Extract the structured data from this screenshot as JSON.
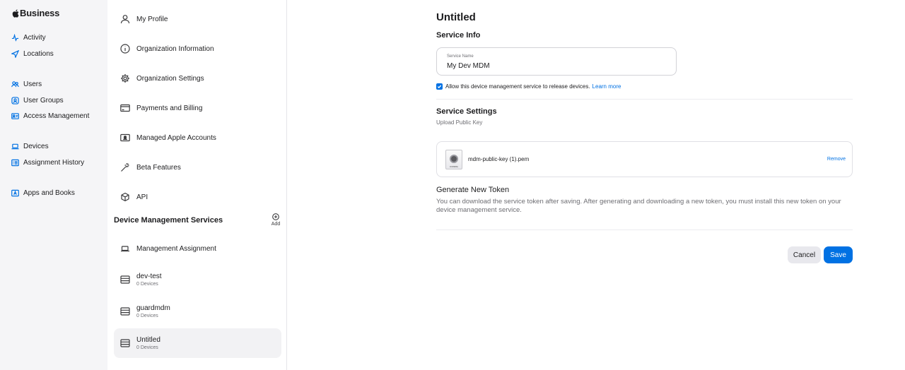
{
  "sidebar": {
    "brand": "Business",
    "items": [
      {
        "label": "Activity",
        "icon": "activity-icon"
      },
      {
        "label": "Locations",
        "icon": "location-arrow-icon"
      },
      {
        "label": "Users",
        "icon": "users-icon"
      },
      {
        "label": "User Groups",
        "icon": "user-group-icon"
      },
      {
        "label": "Access Management",
        "icon": "id-card-icon"
      },
      {
        "label": "Devices",
        "icon": "laptop-icon"
      },
      {
        "label": "Assignment History",
        "icon": "list-icon"
      },
      {
        "label": "Apps and Books",
        "icon": "app-store-icon"
      }
    ]
  },
  "settings_nav": {
    "items": [
      {
        "label": "My Profile",
        "icon": "person-icon"
      },
      {
        "label": "Organization Information",
        "icon": "info-icon"
      },
      {
        "label": "Organization Settings",
        "icon": "gear-icon"
      },
      {
        "label": "Payments and Billing",
        "icon": "credit-card-icon"
      },
      {
        "label": "Managed Apple Accounts",
        "icon": "account-card-icon"
      },
      {
        "label": "Beta Features",
        "icon": "magic-wand-icon"
      },
      {
        "label": "API",
        "icon": "cube-icon"
      }
    ],
    "dms_title": "Device Management Services",
    "add_label": "Add",
    "dms_items": [
      {
        "label": "Management Assignment",
        "icon": "laptop-icon"
      },
      {
        "label": "dev-test",
        "sub": "0 Devices",
        "icon": "server-icon"
      },
      {
        "label": "guardmdm",
        "sub": "0 Devices",
        "icon": "server-icon"
      },
      {
        "label": "Untitled",
        "sub": "0 Devices",
        "icon": "server-icon",
        "selected": true
      }
    ]
  },
  "main": {
    "title": "Untitled",
    "service_info_title": "Service Info",
    "service_name_label": "Service Name",
    "service_name_value": "My Dev MDM",
    "allow_release_text": "Allow this device management service to release devices.",
    "allow_release_checked": true,
    "learn_more": "Learn more",
    "service_settings_title": "Service Settings",
    "upload_label": "Upload Public Key",
    "file_name": "mdm-public-key (1).pem",
    "file_icon_text": "CONFIG",
    "remove_label": "Remove",
    "token_title": "Generate New Token",
    "token_text": "You can download the service token after saving. After generating and downloading a new token, you must install this new token on your device management service.",
    "cancel_label": "Cancel",
    "save_label": "Save"
  },
  "colors": {
    "accent": "#0071e3",
    "sidebar_bg": "#f5f5f7",
    "selected_bg": "#f2f2f4"
  }
}
